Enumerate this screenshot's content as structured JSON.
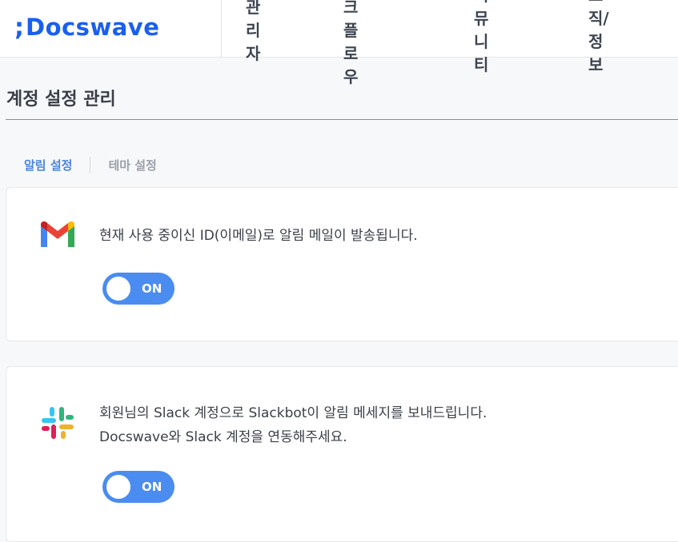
{
  "header": {
    "logo_mark": ";",
    "logo_text": "Docswave",
    "nav": [
      {
        "label": "관리자"
      },
      {
        "label": "워크플로우"
      },
      {
        "label": "커뮤니티"
      },
      {
        "label": "조직/정보"
      }
    ]
  },
  "page": {
    "title": "계정 설정 관리"
  },
  "tabs": [
    {
      "label": "알림 설정",
      "active": true
    },
    {
      "label": "테마 설정",
      "active": false
    }
  ],
  "cards": [
    {
      "icon": "gmail-icon",
      "lines": [
        "현재 사용 중이신 ID(이메일)로 알림 메일이 발송됩니다."
      ],
      "toggle": "ON"
    },
    {
      "icon": "slack-icon",
      "lines": [
        "회원님의 Slack 계정으로 Slackbot이 알림 메세지를 보내드립니다.",
        "Docswave와 Slack 계정을 연동해주세요."
      ],
      "toggle": "ON"
    }
  ],
  "colors": {
    "brand": "#1a5ff0",
    "active_tab": "#4a84e0",
    "toggle_on": "#4a8cf0"
  }
}
